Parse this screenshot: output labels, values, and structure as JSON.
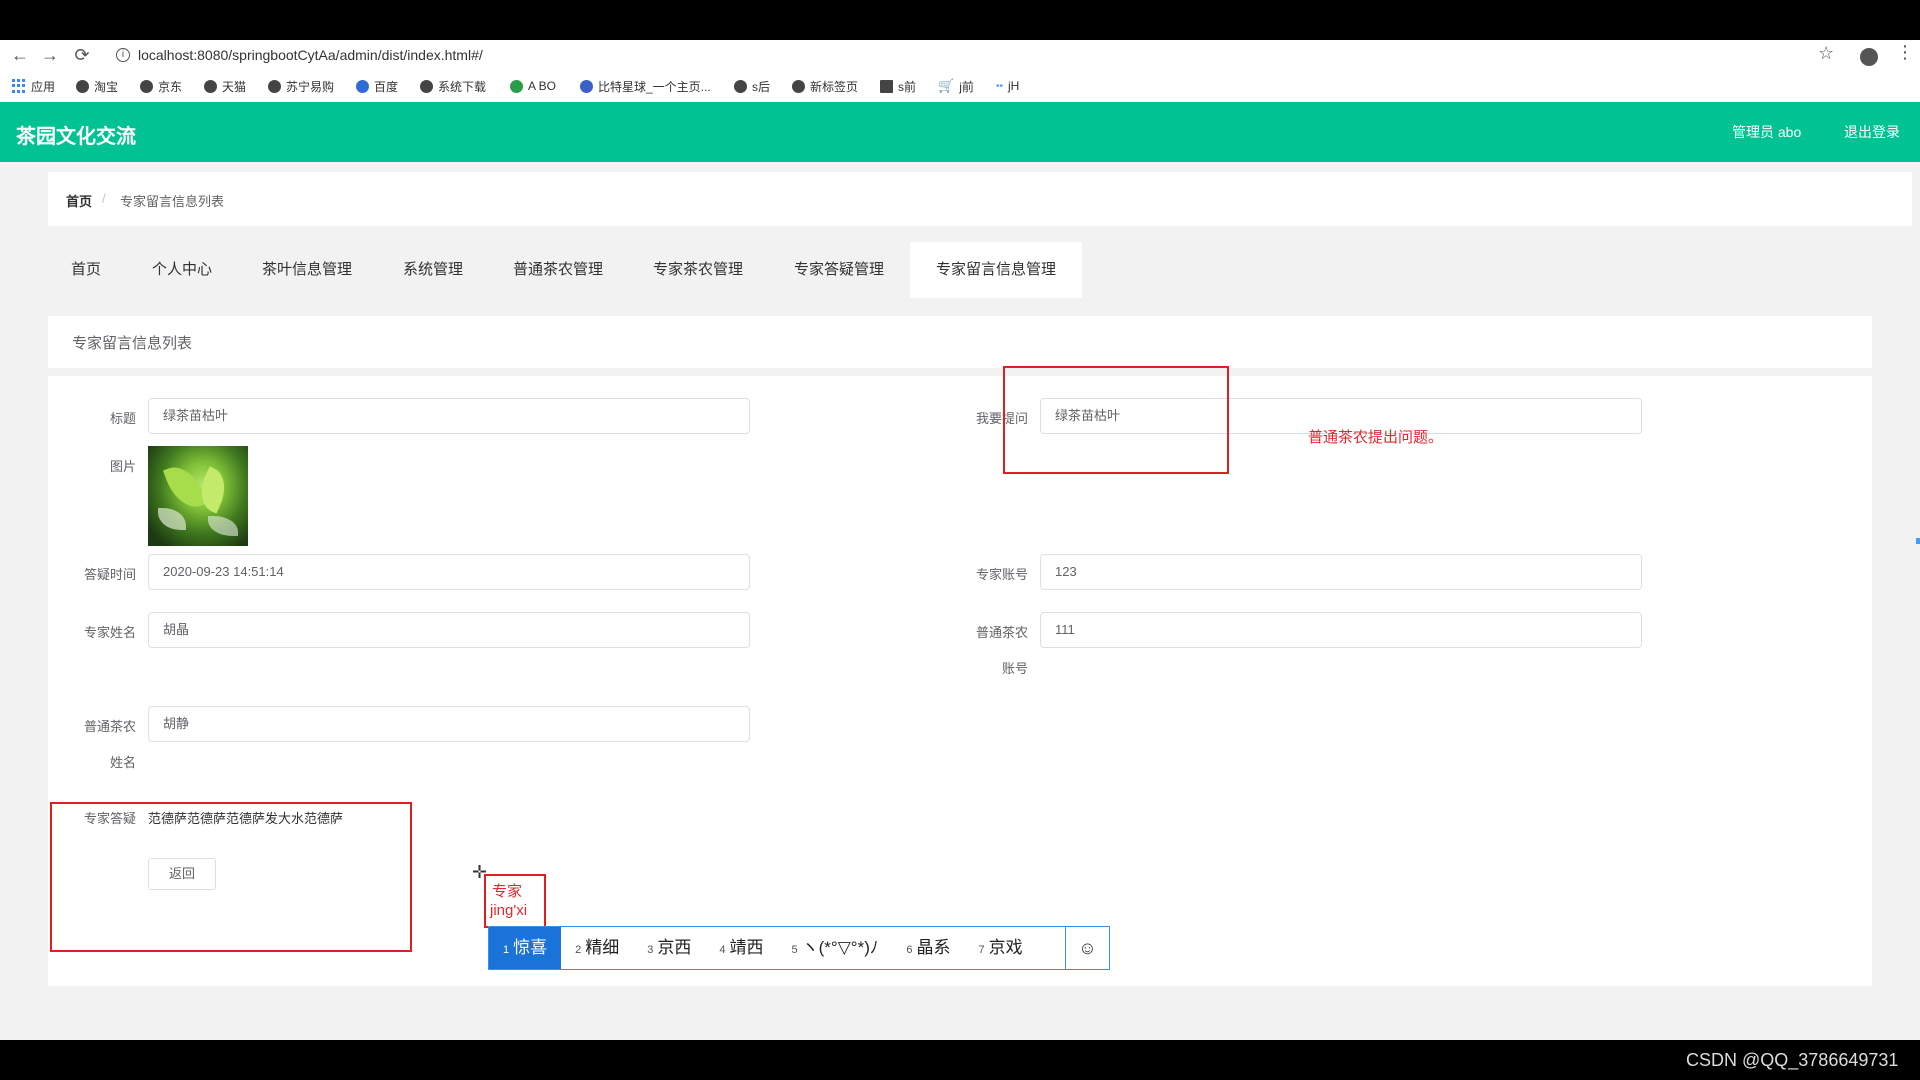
{
  "browser": {
    "url": "localhost:8080/springbootCytAa/admin/dist/index.html#/",
    "bookmarks": [
      "应用",
      "淘宝",
      "京东",
      "天猫",
      "苏宁易购",
      "百度",
      "系统下载",
      "A BO",
      "比特星球_一个主页...",
      "s后",
      "新标签页",
      "s前",
      "j前",
      "jH"
    ]
  },
  "header": {
    "title": "茶园文化交流",
    "admin": "管理员 abo",
    "logout": "退出登录"
  },
  "breadcrumb": {
    "home": "首页",
    "separator": "/",
    "current": "专家留言信息列表"
  },
  "tabs": [
    "首页",
    "个人中心",
    "茶叶信息管理",
    "系统管理",
    "普通茶农管理",
    "专家茶农管理",
    "专家答疑管理",
    "专家留言信息管理"
  ],
  "list_title": "专家留言信息列表",
  "form": {
    "title_label": "标题",
    "title_value": "绿茶苗枯叶",
    "question_label": "我要提问",
    "question_value": "绿茶苗枯叶",
    "image_label": "图片",
    "time_label": "答疑时间",
    "time_value": "2020-09-23 14:51:14",
    "expert_account_label": "专家账号",
    "expert_account_value": "123",
    "expert_name_label": "专家姓名",
    "expert_name_value": "胡晶",
    "farmer_account_label_1": "普通茶农",
    "farmer_account_label_2": "账号",
    "farmer_account_value": "111",
    "farmer_name_label_1": "普通茶农",
    "farmer_name_label_2": "姓名",
    "farmer_name_value": "胡静",
    "answer_label": "专家答疑",
    "answer_value": "范德萨范德萨范德萨发大水范德萨",
    "back_button": "返回"
  },
  "annotation": "普通茶农提出问题。",
  "ime": {
    "preedit": "专家",
    "pinyin": "jing'xi",
    "candidates": [
      {
        "n": "1",
        "text": "惊喜"
      },
      {
        "n": "2",
        "text": "精细"
      },
      {
        "n": "3",
        "text": "京西"
      },
      {
        "n": "4",
        "text": "靖西"
      },
      {
        "n": "5",
        "text": "ヽ(*°▽°*)ﾉ"
      },
      {
        "n": "6",
        "text": "晶系"
      },
      {
        "n": "7",
        "text": "京戏"
      }
    ],
    "emoji": "☺"
  },
  "watermark": "CSDN @QQ_3786649731",
  "colors": {
    "brand": "#00c292",
    "annotation_red": "#e02020",
    "ime_selected": "#1a73d9"
  }
}
